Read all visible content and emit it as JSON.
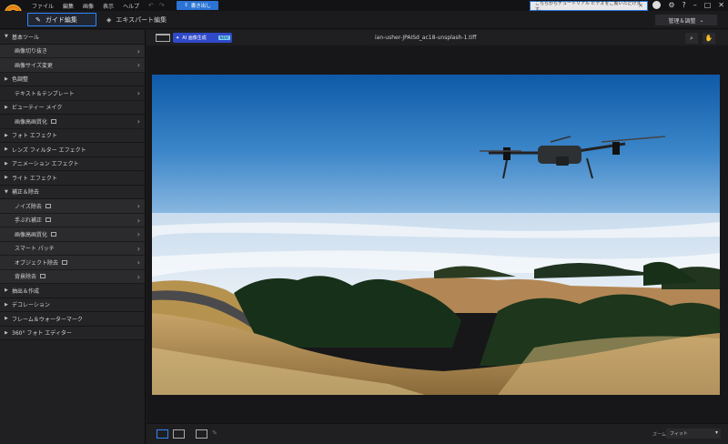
{
  "menu": {
    "items": [
      "ファイル",
      "編集",
      "画像",
      "表示",
      "ヘルプ"
    ],
    "export_label": "書き出し",
    "tutorial_text": "こちらからチュートリアル ビデオをご覧いただけます。",
    "manage_label": "管理＆調整"
  },
  "modes": {
    "guide": "ガイド編集",
    "expert": "エキスパート編集"
  },
  "panel": {
    "sections": [
      {
        "label": "基本ツール",
        "expanded": true,
        "items": [
          "画像切り抜き",
          "画像サイズ変更"
        ]
      },
      {
        "label": "色調整",
        "expanded": false
      },
      {
        "label": "テキスト＆テンプレート",
        "sub": true
      },
      {
        "label": "ビューティー メイク",
        "expanded": false
      },
      {
        "label": "画像高画質化",
        "sub": true,
        "ext": true
      },
      {
        "label": "フォト エフェクト",
        "expanded": false
      },
      {
        "label": "レンズ フィルター エフェクト",
        "expanded": false
      },
      {
        "label": "アニメーション エフェクト",
        "expanded": false
      },
      {
        "label": "ライト エフェクト",
        "expanded": false
      },
      {
        "label": "補正＆除去",
        "expanded": true,
        "items": [
          "ノイズ除去",
          "手ぶれ補正",
          "画像高画質化",
          "スマート パッチ",
          "オブジェクト除去",
          "背景除去"
        ]
      },
      {
        "label": "抽出＆作成",
        "expanded": false
      },
      {
        "label": "デコレーション",
        "expanded": false
      },
      {
        "label": "フレーム＆ウォーターマーク",
        "expanded": false
      },
      {
        "label": "360° フォト エディター",
        "expanded": false
      }
    ]
  },
  "toolbar": {
    "ai_label": "AI 画像生成",
    "ai_badge": "NEW",
    "filename": "ian-usher-JPAISd_ac18-unsplash-1.tiff"
  },
  "bottom": {
    "zoom_label": "ズーム",
    "zoom_value": "フィット"
  },
  "icons": {
    "logo": "app-logo-icon",
    "search": "search-icon",
    "hand": "hand-icon",
    "folder": "folder-icon"
  },
  "colors": {
    "accent": "#2f86ff",
    "export": "#2b74d6",
    "ai": "#3049c9"
  }
}
